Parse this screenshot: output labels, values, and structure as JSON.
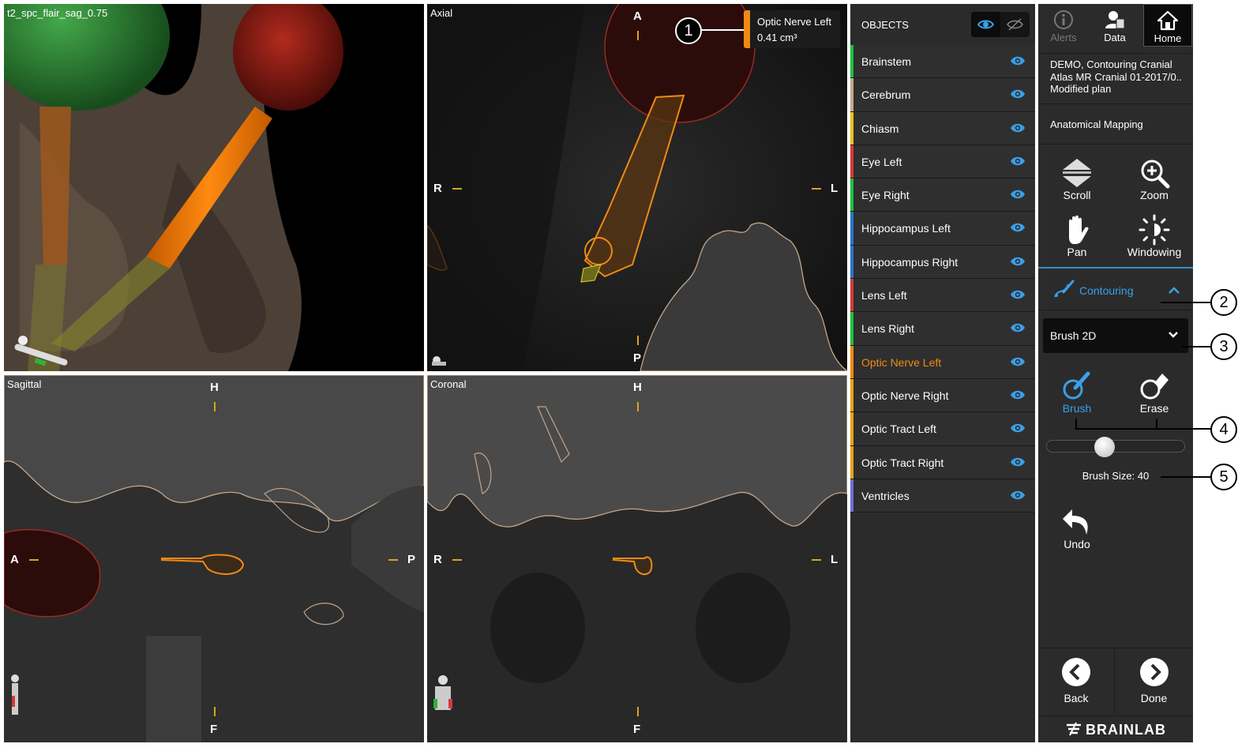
{
  "viewports": {
    "three_d": {
      "title": "t2_spc_flair_sag_0.75"
    },
    "axial": {
      "title": "Axial",
      "top": "A",
      "bottom": "P",
      "left": "R",
      "right": "L"
    },
    "sagittal": {
      "title": "Sagittal",
      "top": "H",
      "bottom": "F",
      "left": "A",
      "right": "P"
    },
    "coronal": {
      "title": "Coronal",
      "top": "H",
      "bottom": "F",
      "left": "R",
      "right": "L"
    }
  },
  "tooltip": {
    "name": "Optic Nerve Left",
    "volume": "0.41 cm³",
    "color": "#f08a12"
  },
  "callouts": [
    "1",
    "2",
    "3",
    "4",
    "5"
  ],
  "objects": {
    "header": "OBJECTS",
    "items": [
      {
        "label": "Brainstem",
        "color": "#1fbf3f"
      },
      {
        "label": "Cerebrum",
        "color": "#c8a88a"
      },
      {
        "label": "Chiasm",
        "color": "#e6c21e"
      },
      {
        "label": "Eye Left",
        "color": "#d23a3a"
      },
      {
        "label": "Eye Right",
        "color": "#1fbf3f"
      },
      {
        "label": "Hippocampus Left",
        "color": "#2b73c8"
      },
      {
        "label": "Hippocampus Right",
        "color": "#2b73c8"
      },
      {
        "label": "Lens Left",
        "color": "#d23a3a"
      },
      {
        "label": "Lens Right",
        "color": "#1fbf3f"
      },
      {
        "label": "Optic Nerve Left",
        "color": "#f08a12"
      },
      {
        "label": "Optic Nerve Right",
        "color": "#e6a21e"
      },
      {
        "label": "Optic Tract Left",
        "color": "#e6a21e"
      },
      {
        "label": "Optic Tract Right",
        "color": "#e6a21e"
      },
      {
        "label": "Ventricles",
        "color": "#6f6fd0"
      }
    ]
  },
  "topbar": {
    "alerts": "Alerts",
    "data": "Data",
    "home": "Home"
  },
  "info": {
    "line1": "DEMO, Contouring Cranial",
    "line2": "Atlas MR Cranial 01-2017/0...",
    "line3": "Modified plan"
  },
  "mapping": "Anatomical Mapping",
  "tools": {
    "scroll": "Scroll",
    "zoom": "Zoom",
    "pan": "Pan",
    "windowing": "Windowing"
  },
  "contouring": "Contouring",
  "brush_mode": "Brush 2D",
  "brush_tools": {
    "brush": "Brush",
    "erase": "Erase"
  },
  "brush_size": {
    "label": "Brush Size: 40",
    "level": 0.42
  },
  "undo": "Undo",
  "nav": {
    "back": "Back",
    "done": "Done"
  },
  "brand": "BRAINLAB"
}
